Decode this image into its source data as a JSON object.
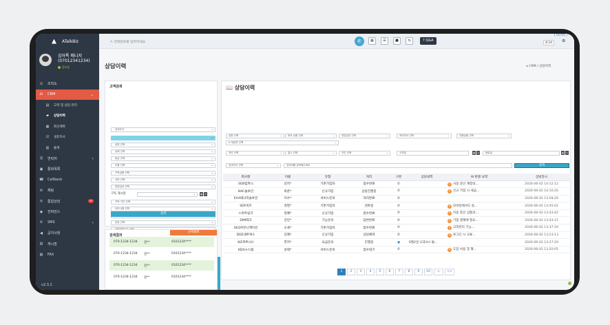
{
  "app": {
    "name": "ATalkBiz"
  },
  "profile": {
    "name": "김아톡 매니저",
    "phone": "(07012341234)",
    "status": "접속중"
  },
  "nav": [
    {
      "label": "조직도",
      "icon": "org-icon"
    },
    {
      "label": "CRM",
      "icon": "headset-icon"
    },
    {
      "label": "고객 및 상담 관리",
      "icon": "list-icon"
    },
    {
      "label": "상담이력",
      "icon": "book-icon"
    },
    {
      "label": "회신예약",
      "icon": "calendar-icon"
    },
    {
      "label": "설문조사",
      "icon": "survey-icon"
    },
    {
      "label": "통계",
      "icon": "chart-icon"
    },
    {
      "label": "연락처",
      "icon": "contact-icon"
    },
    {
      "label": "통화목록",
      "icon": "call-list-icon"
    },
    {
      "label": "Callback",
      "icon": "callback-icon"
    },
    {
      "label": "채팅",
      "icon": "chat-icon"
    },
    {
      "label": "통합상담",
      "icon": "consult-icon",
      "badge": "59"
    },
    {
      "label": "컨퍼런스",
      "icon": "conference-icon"
    },
    {
      "label": "SMS",
      "icon": "sms-icon"
    },
    {
      "label": "공지사항",
      "icon": "notice-icon"
    },
    {
      "label": "게시판",
      "icon": "board-icon"
    },
    {
      "label": "FAX",
      "icon": "fax-icon"
    }
  ],
  "version": "v2.3.1",
  "topbar": {
    "phone_placeholder": "전화번호를 입력하세요",
    "qa": "Q&A",
    "lang": "한국어",
    "clock": "[ 05:05 ]"
  },
  "page": {
    "title": "상담이력",
    "crumb_home": "CRM",
    "crumb_current": "상담이력"
  },
  "left": {
    "title": "고객검색",
    "selects": [
      "검색조건",
      "",
      "공휴 선택",
      "상태 선택",
      "등급 선택",
      "주황 선택",
      "구독상품 선택",
      "서비 선택",
      "영업담당 선택"
    ],
    "date_label": "구독 개시일",
    "selects2": [
      "구독 기간 선택",
      "트라시행 선택",
      "프로그램 선택",
      "담당 선택",
      "간편결제유무 선택"
    ],
    "search": "검색"
  },
  "results": {
    "title": "검색결과",
    "tab": "선택해제",
    "rows": [
      {
        "phone": "070-1234-1234",
        "name": "김**",
        "tel": "0101234****"
      },
      {
        "phone": "070-1234-1234",
        "name": "김**",
        "tel": "0101234****"
      },
      {
        "phone": "070-1234-1234",
        "name": "김**",
        "tel": "0101234****"
      },
      {
        "phone": "070-1234-1234",
        "name": "김**",
        "tel": "0101234****"
      }
    ]
  },
  "main": {
    "title": "상담이력",
    "filters_row1": [
      "유형 선택",
      "문의 상품 선택",
      "영업담당 선택",
      "처리부서 선택",
      "진행상황 선택"
    ],
    "filter_row1b": "A 대분류 선택",
    "filters_row2": [
      "처리 선택",
      "일시 선택",
      "지인 선택"
    ],
    "start_placeholder": "시작일",
    "end_placeholder": "종료일",
    "keyword_select": "검색조건 선택",
    "keyword_placeholder": "검색어를 입력해주세요",
    "search": "검색",
    "columns": [
      "회사명",
      "이름",
      "유형",
      "처리",
      "구분",
      "상담내역",
      "AI 판결 요약",
      "상담일시"
    ],
    "rows": [
      {
        "company": "SEB컴퍼니",
        "name": "김지*",
        "type": "기존가입자",
        "status": "접수완료",
        "memo": "",
        "ai": "사용 중인 계정의...",
        "date": "2026-06-02 14:12:12"
      },
      {
        "company": "BAC솔루션",
        "name": "박준*",
        "type": "신규가입",
        "status": "상담진행중",
        "memo": "",
        "ai": "신규 가입 시 세금...",
        "date": "2026-06-02 14:10:20"
      },
      {
        "company": "EAA테너지솔루션",
        "name": "이수*",
        "type": "서비스문의",
        "status": "처리완료",
        "memo": "",
        "ai": "",
        "date": "2026-06-02 13:58:29"
      },
      {
        "company": "SDF비즈",
        "name": "최영*",
        "type": "기존가입자",
        "status": "검토중",
        "memo": "",
        "ai": "모바일에서도 동...",
        "date": "2026-06-02 13:45:02"
      },
      {
        "company": "스마트링크",
        "name": "정혜*",
        "type": "신규가입",
        "status": "접수완료",
        "memo": "",
        "ai": "이용 중인 상품의...",
        "date": "2026-06-02 13:43:42"
      },
      {
        "company": "DIM테크",
        "name": "강민*",
        "type": "기능문의",
        "status": "답변완료",
        "memo": "",
        "ai": "기업 결제에 필요...",
        "date": "2026-06-02 13:43:37"
      },
      {
        "company": "SEQ커뮤니케이션",
        "name": "오세*",
        "type": "기존가입자",
        "status": "접수완료",
        "memo": "",
        "ai": "고객관리 기능...",
        "date": "2026-06-02 13:37:19"
      },
      {
        "company": "DDE네트웍스",
        "name": "김재*",
        "type": "신규가입",
        "status": "상담예약",
        "memo": "",
        "ai": "로그인 시 오류...",
        "date": "2026-06-02 13:23:13"
      },
      {
        "company": "AIE파트너스",
        "name": "한지*",
        "type": "요금문의",
        "status": "진행중",
        "memo": "6월2일 오후4시 통...",
        "ai": "",
        "date": "2026-06-02 13:27:29"
      },
      {
        "company": "KDS시스템",
        "name": "윤태*",
        "type": "서비스문의",
        "status": "접수대기",
        "memo": "",
        "ai": "도입 비용 및 월...",
        "date": "2026-06-02 13:20:05"
      }
    ],
    "pages": [
      "1",
      "2",
      "3",
      "4",
      "5",
      "6",
      "7",
      "8",
      "9",
      "10",
      ">",
      ">>"
    ]
  }
}
